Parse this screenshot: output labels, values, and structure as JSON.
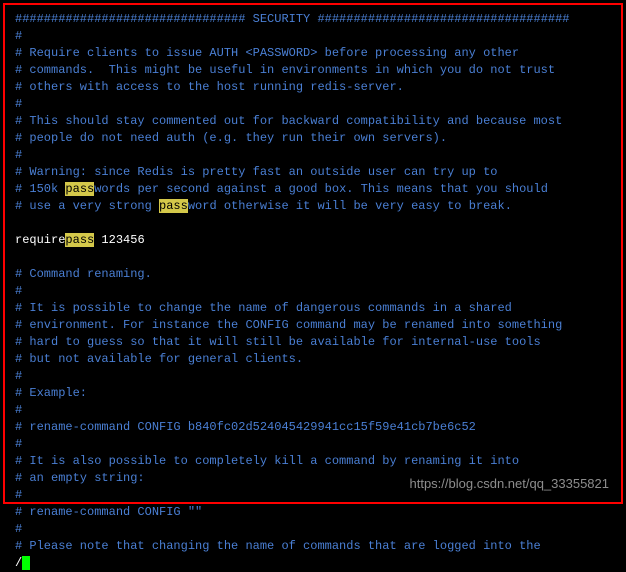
{
  "header": {
    "hashesLeft": "################################",
    "title": " SECURITY ",
    "hashesRight": "###################################"
  },
  "block1": {
    "l1": "# Require clients to issue AUTH <PASSWORD> before processing any other",
    "l2": "# commands.  This might be useful in environments in which you do not trust",
    "l3": "# others with access to the host running redis-server.",
    "l4": "#",
    "l5": "# This should stay commented out for backward compatibility and because most",
    "l6": "# people do not need auth (e.g. they run their own servers).",
    "l7": "#",
    "l8": "# Warning: since Redis is pretty fast an outside user can try up to",
    "l9a": "# 150k ",
    "l9b": "pass",
    "l9c": "words per second against a good box. This means that you should",
    "l10a": "# use a very strong ",
    "l10b": "pass",
    "l10c": "word otherwise it will be very easy to break."
  },
  "config": {
    "require": "require",
    "pass": "pass",
    "value": " 123456"
  },
  "block2": {
    "l1": "# Command renaming.",
    "l2": "#",
    "l3": "# It is possible to change the name of dangerous commands in a shared",
    "l4": "# environment. For instance the CONFIG command may be renamed into something",
    "l5": "# hard to guess so that it will still be available for internal-use tools",
    "l6": "# but not available for general clients.",
    "l7": "#",
    "l8": "# Example:",
    "l9": "#",
    "l10": "# rename-command CONFIG b840fc02d524045429941cc15f59e41cb7be6c52",
    "l11": "#",
    "l12": "# It is also possible to completely kill a command by renaming it into",
    "l13": "# an empty string:",
    "l14": "#",
    "l15": "# rename-command CONFIG \"\"",
    "l16": "#",
    "l17": "# Please note that changing the name of commands that are logged into the"
  },
  "search": {
    "prefix": "/"
  },
  "watermark": "https://blog.csdn.net/qq_33355821"
}
